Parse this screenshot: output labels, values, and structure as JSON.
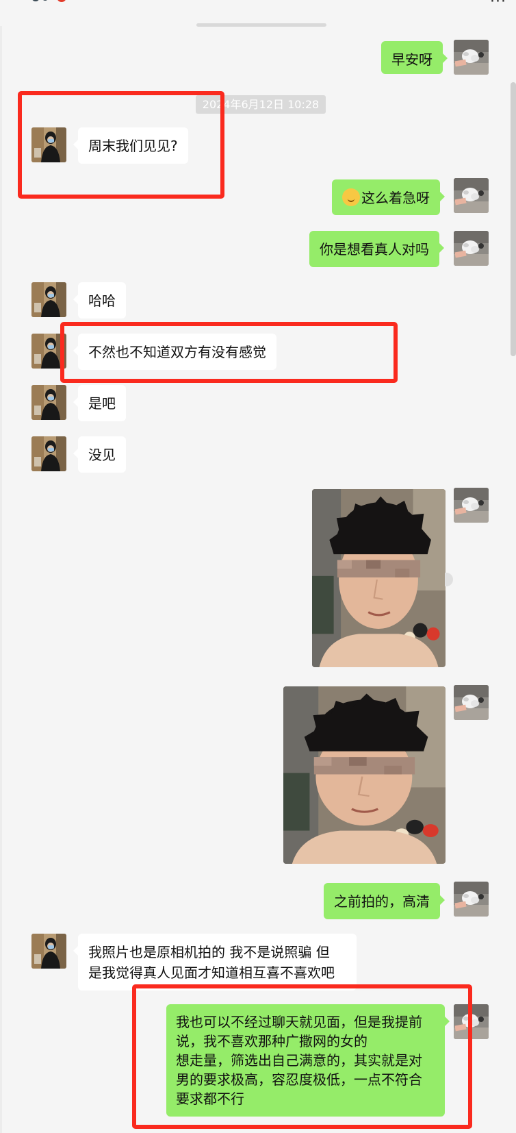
{
  "topbar": {
    "more_icon": "more-dots-icon"
  },
  "timestamp": "2024年6月12日 10:28",
  "messages": [
    {
      "side": "out",
      "type": "text",
      "text": "早安呀"
    },
    {
      "side": "in",
      "type": "text",
      "text": "周末我们见见?"
    },
    {
      "side": "out",
      "type": "text",
      "text": "这么着急呀",
      "emoji": "thinking-face-emoji"
    },
    {
      "side": "out",
      "type": "text",
      "text": "你是想看真人对吗"
    },
    {
      "side": "in",
      "type": "text",
      "text": "哈哈"
    },
    {
      "side": "in",
      "type": "text",
      "text": "不然也不知道双方有没有感觉"
    },
    {
      "side": "in",
      "type": "text",
      "text": "是吧"
    },
    {
      "side": "in",
      "type": "text",
      "text": "没见"
    },
    {
      "side": "out",
      "type": "image",
      "image": "selfie-photo"
    },
    {
      "side": "out",
      "type": "image",
      "image": "selfie-photo"
    },
    {
      "side": "out",
      "type": "text",
      "text": "之前拍的，高清"
    },
    {
      "side": "in",
      "type": "text",
      "lines": [
        "我照片也是原相机拍的 我不是说照骗 但",
        "是我觉得真人见面才知道相互喜不喜欢吧"
      ]
    },
    {
      "side": "out",
      "type": "text",
      "lines": [
        "我也可以不经过聊天就见面，但是我提前",
        "说，我不喜欢那种广撒网的女的",
        "想走量，筛选出自己满意的，其实就是对",
        "男的要求极高，容忍度极低，一点不符合",
        "要求都不行"
      ]
    }
  ],
  "colors": {
    "outgoing_bubble": "#95ec69",
    "incoming_bubble": "#ffffff",
    "highlight_box": "#fa2a1e",
    "background": "#f5f5f5"
  }
}
